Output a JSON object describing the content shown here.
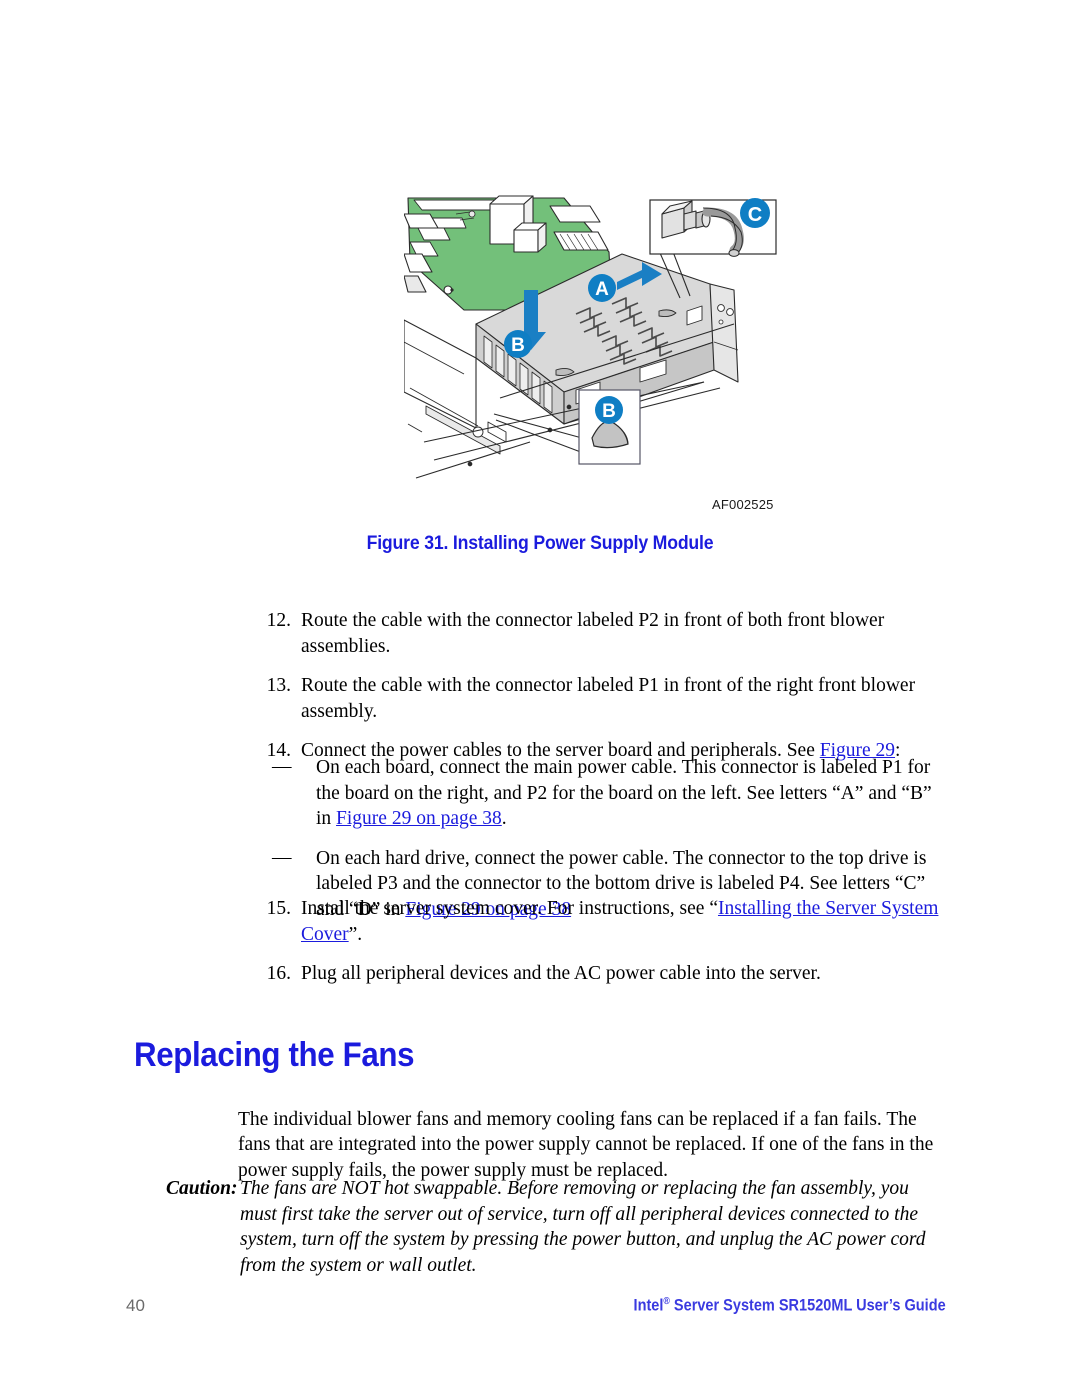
{
  "figure": {
    "id_label": "AF002525",
    "caption": "Figure 31. Installing Power Supply Module",
    "callouts": [
      {
        "letter": "A",
        "meaning": "slide-direction-arrow"
      },
      {
        "letter": "B",
        "meaning": "seat-down-arrow"
      },
      {
        "letter": "B",
        "meaning": "retention-tab-detail"
      },
      {
        "letter": "C",
        "meaning": "ac-power-connector-detail"
      }
    ],
    "accent_color": "#0f7ec4",
    "board_color": "#6abf6a"
  },
  "steps": [
    {
      "number": "12.",
      "text": "Route the cable with the connector labeled P2 in front of both front blower assemblies."
    },
    {
      "number": "13.",
      "text": "Route the cable with the connector labeled P1 in front of the right front blower assembly."
    },
    {
      "number": "14.",
      "text_before": "Connect the power cables to the server board and peripherals. See ",
      "xref": "Figure 29",
      "text_after": ":"
    }
  ],
  "dash_items": [
    {
      "dash": "—",
      "part1": "On each board, connect the main power cable. This connector is labeled P1 for the board on the right, and P2 for the board on the left. See letters “A” and “B” in ",
      "xref": "Figure 29 on page 38",
      "part2": "."
    },
    {
      "dash": "—",
      "part1": "On each hard drive, connect the power cable. The connector to the top drive is labeled P3 and the connector to the bottom drive is labeled P4. See letters “C” and “D” in ",
      "xref": "Figure 29 on page 38",
      "part2": ""
    }
  ],
  "steps_after": [
    {
      "number": "15.",
      "text_before": "Install the server system cover. For instructions, see “",
      "xref": "Installing the Server System Cover",
      "text_after": "”."
    },
    {
      "number": "16.",
      "text_before": "Plug all peripheral devices and the AC power cable into the server.",
      "xref": "",
      "text_after": ""
    }
  ],
  "section": {
    "heading": "Replacing the Fans",
    "intro": "The individual blower fans and memory cooling fans can be replaced if a fan fails. The fans that are integrated into the power supply cannot be replaced. If one of the fans in the power supply fails, the power supply must be replaced.",
    "caution_label": "Caution:",
    "caution_text": "The fans are NOT hot swappable. Before removing or replacing the fan assembly, you must first take the server out of service, turn off all peripheral devices connected to the system, turn off the system by pressing the power button, and unplug the AC power cord from the system or wall outlet."
  },
  "footer": {
    "page_number": "40",
    "title_prefix": "Intel",
    "registered_mark": "®",
    "title_suffix": " Server System SR1520ML User’s Guide",
    "link_color": "#1b1bdd"
  }
}
